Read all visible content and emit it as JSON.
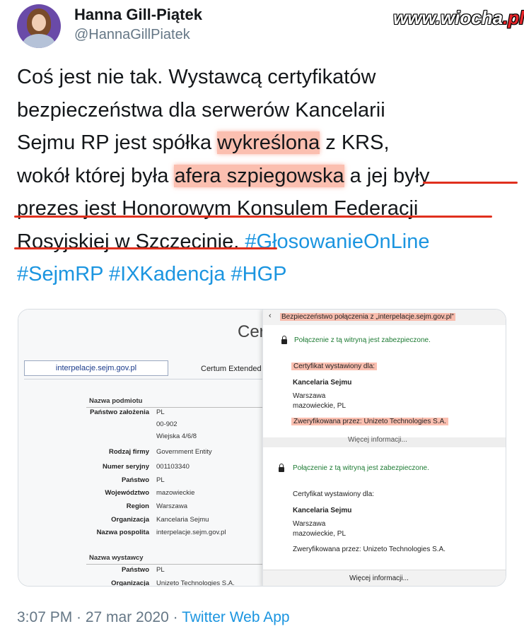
{
  "author": {
    "name": "Hanna Gill-Piątek",
    "handle": "@HannaGillPiatek"
  },
  "watermark": {
    "site": "www.wiocha",
    "tld": ".pl"
  },
  "tweet": {
    "line1": "Coś jest nie tak. Wystawcą certyfikatów",
    "line2": "bezpieczeństwa dla serwerów Kancelarii",
    "line3": "Sejmu RP jest spółka wykreślona z KRS,",
    "line4_a": "wokół której była ",
    "line4_hl": "afera szpiegowska",
    "line4_b": " a jej były",
    "line5": "prezes jest Honorowym Konsulem Federacji",
    "line6_a": "Rosyjskiej w Szczecinie.",
    "line6_tag": "#GłosowanieOnLine",
    "line7_tags": "#SejmRP #IXKadencja #HGP"
  },
  "certificate_viewer": {
    "title_partial": "Cer",
    "url": "interpelacje.sejm.gov.pl",
    "tab": "Certum Extended",
    "subject_header": "Nazwa podmiotu",
    "fields": [
      {
        "k": "Państwo założenia",
        "v": "PL"
      },
      {
        "k": "",
        "v": "00-902"
      },
      {
        "k": "",
        "v": "Wiejska 4/6/8"
      },
      {
        "k": "Rodzaj firmy",
        "v": "Government Entity"
      },
      {
        "k": "Numer seryjny",
        "v": "001103340"
      },
      {
        "k": "Państwo",
        "v": "PL"
      },
      {
        "k": "Województwo",
        "v": "mazowieckie"
      },
      {
        "k": "Region",
        "v": "Warszawa"
      },
      {
        "k": "Organizacja",
        "v": "Kancelaria Sejmu"
      },
      {
        "k": "Nazwa pospolita",
        "v": "interpelacje.sejm.gov.pl"
      }
    ],
    "issuer_header": "Nazwa wystawcy",
    "issuer_fields": [
      {
        "k": "Państwo",
        "v": "PL"
      },
      {
        "k": "Organizacja",
        "v": "Unizeto Technologies S.A."
      }
    ]
  },
  "security_popup": {
    "header": "Bezpieczeństwo połączenia z „interpelacje.sejm.gov.pl”",
    "secure": "Połączenie z tą witryną jest zabezpieczone.",
    "issued_for": "Certyfikat wystawiony dla:",
    "org": "Kancelaria Sejmu",
    "city": "Warszawa",
    "region": "mazowieckie, PL",
    "verified": "Zweryfikowana przez: Unizeto Technologies S.A.",
    "more_partial": "Więcej informacji...",
    "more": "Więcej informacji..."
  },
  "footer": {
    "time": "3:07 PM · 27 mar 2020 · ",
    "app": "Twitter Web App"
  }
}
